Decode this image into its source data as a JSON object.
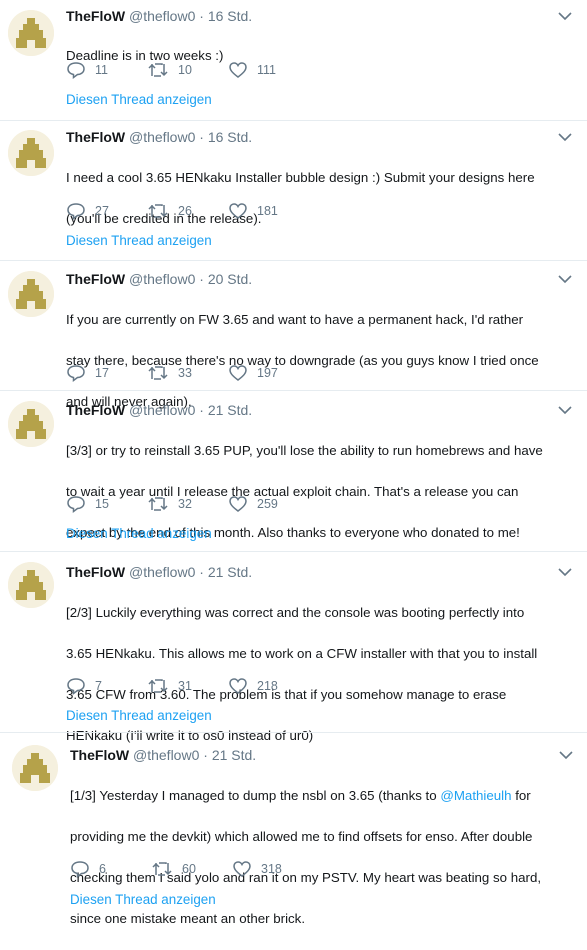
{
  "colors": {
    "accent": "#1da1f2",
    "muted": "#657786",
    "text": "#14171a",
    "divider": "#e6ecf0",
    "avatar_bg": "#f5f0de",
    "avatar_fg": "#b5a24a"
  },
  "icons": {
    "reply": "reply-icon",
    "retweet": "retweet-icon",
    "like": "heart-icon",
    "caret": "chevron-down-icon",
    "avatar": "avatar-pixel-logo"
  },
  "tweets": [
    {
      "name": "TheFloW",
      "handle": "@theflow0",
      "dot": "·",
      "time": "16 Std.",
      "lines": [
        "Deadline is in two weeks :)"
      ],
      "replies": "11",
      "retweets": "10",
      "likes": "111",
      "thread": "Diesen Thread anzeigen"
    },
    {
      "name": "TheFloW",
      "handle": "@theflow0",
      "dot": "·",
      "time": "16 Std.",
      "lines": [
        "I need a cool 3.65 HENkaku Installer bubble design :) Submit your designs here",
        "(you'll be credited in the release)."
      ],
      "replies": "27",
      "retweets": "26",
      "likes": "181",
      "thread": "Diesen Thread anzeigen"
    },
    {
      "name": "TheFloW",
      "handle": "@theflow0",
      "dot": "·",
      "time": "20 Std.",
      "lines": [
        "If you are currently on FW 3.65 and want to have a permanent hack, I'd rather",
        "stay there, because there's no way to downgrade (as you guys know I tried once",
        "and will never again)."
      ],
      "replies": "17",
      "retweets": "33",
      "likes": "197",
      "thread": ""
    },
    {
      "name": "TheFloW",
      "handle": "@theflow0",
      "dot": "·",
      "time": "21 Std.",
      "lines": [
        "[3/3] or try to reinstall 3.65 PUP, you'll lose the ability to run homebrews and have",
        "to wait a year until I release the actual exploit chain. That's a release you can",
        "expect by the end of this month. Also thanks to everyone who donated to me!"
      ],
      "replies": "15",
      "retweets": "32",
      "likes": "259",
      "thread": "Diesen Thread anzeigen"
    },
    {
      "name": "TheFloW",
      "handle": "@theflow0",
      "dot": "·",
      "time": "21 Std.",
      "lines": [
        "[2/3] Luckily everything was correct and the console was booting perfectly into",
        "3.65 HENkaku. This allows me to work on a CFW installer with that you to install",
        "3.65 CFW from 3.60. The problem is that if you somehow manage to erase",
        "HENkaku (I'll write it to os0 instead of ur0)"
      ],
      "replies": "7",
      "retweets": "31",
      "likes": "218",
      "thread": "Diesen Thread anzeigen"
    },
    {
      "name": "TheFloW",
      "handle": "@theflow0",
      "dot": "·",
      "time": "21 Std.",
      "line1_pre": "[1/3] Yesterday I managed to dump the nsbl on 3.65 (thanks to ",
      "mention": "@Mathieulh",
      "line1_post": " for",
      "lines": [
        "providing me the devkit) which allowed me to find offsets for enso. After double",
        "checking them I said yolo and ran it on my PSTV. My heart was beating so hard,",
        "since one mistake meant an other brick."
      ],
      "replies": "6",
      "retweets": "60",
      "likes": "318",
      "thread": "Diesen Thread anzeigen"
    }
  ]
}
